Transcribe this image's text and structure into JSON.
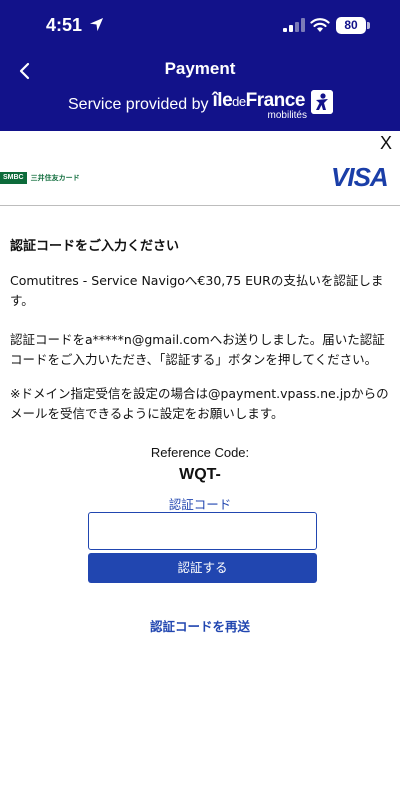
{
  "status_bar": {
    "time": "4:51",
    "battery": "80"
  },
  "header": {
    "title": "Payment",
    "subtitle": "Service provided by",
    "brand_ile": "île",
    "brand_de": "de",
    "brand_france": "France",
    "brand_mobilites": "mobilités"
  },
  "close_label": "X",
  "logos": {
    "smbc_box": "SMBC",
    "smbc_text": "三井住友カード",
    "visa": "VISA"
  },
  "content": {
    "heading": "認証コードをご入力ください",
    "para1": "Comutitres - Service Navigoへ€30,75 EURの支払いを認証します。",
    "para2": "認証コードをa*****n@gmail.comへお送りしました。届いた認証コードをご入力いただき、「認証する」ボタンを押してください。",
    "para3": "※ドメイン指定受信を設定の場合は@payment.vpass.ne.jpからのメールを受信できるように設定をお願いします。",
    "reference_label": "Reference Code:",
    "reference_value": "WQT-",
    "code_label": "認証コード",
    "code_value": "",
    "submit_label": "認証する",
    "resend_label": "認証コードを再送"
  },
  "colors": {
    "header_bg": "#12128a",
    "accent": "#2146b0",
    "visa": "#1a3ea8",
    "smbc": "#0d6b3a"
  }
}
